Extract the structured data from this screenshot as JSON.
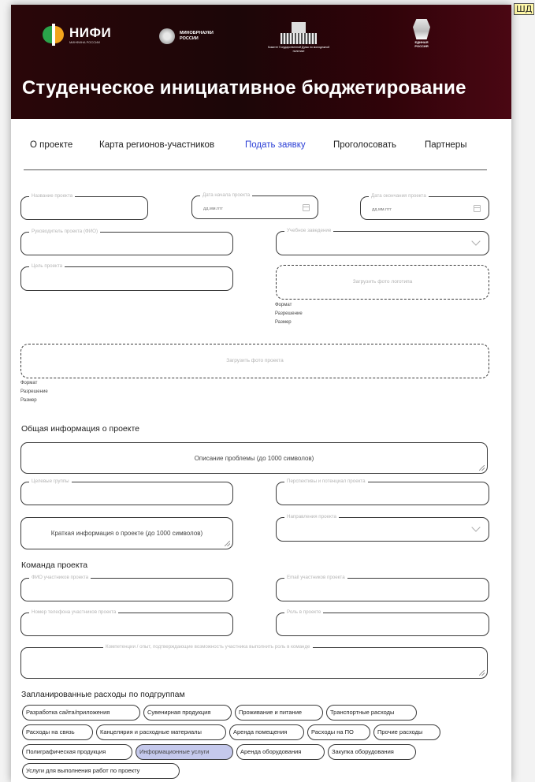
{
  "corner_tag": "ШД",
  "header": {
    "nifi_name": "НИФИ",
    "nifi_sub": "МИНФИНА РОССИИ",
    "min_line1": "МИНОБРНАУКИ",
    "min_line2": "РОССИИ",
    "duma_text": "Комитет Государственной Думы по молодежной политике",
    "er_text1": "ЕДИНАЯ",
    "er_text2": "РОССИЯ",
    "title": "Студенческое инициативное бюджетирование"
  },
  "nav": {
    "items": [
      "О проекте",
      "Карта регионов-участников",
      "Подать заявку",
      "Проголосовать",
      "Партнеры"
    ],
    "active": "Подать заявку"
  },
  "form": {
    "project_name": "Название проекта",
    "start_date": "Дата начала проекта",
    "end_date": "Дата окончания проекта",
    "date_placeholder": "дд.мм.гггг",
    "leader": "Руководитель проекта (ФИО)",
    "institution": "Учебное заведение",
    "goal": "Цель проекта",
    "upload_logo": "Загрузить фото логотипа",
    "format": "Формат",
    "resolution": "Разрешение",
    "size": "Размер",
    "upload_photo": "Загрузить фото проекта"
  },
  "general": {
    "title": "Общая информация о проекте",
    "problem": "Описание проблемы (до 1000 символов)",
    "target_groups": "Целевые группы",
    "prospects": "Перспективы и потенциал проекта",
    "brief": "Краткая информация о проекте (до 1000 символов)",
    "directions": "Направления проекта"
  },
  "team": {
    "title": "Команда проекта",
    "names": "ФИО участников проекта",
    "email": "Email участников проекта",
    "phone": "Номер телефона участников проекта",
    "role": "Роль в проекте",
    "competencies": "Компетенции / опыт, подтверждающие возможность участника выполнить роль в команде"
  },
  "expenses": {
    "title": "Запланированные расходы по подгруппам",
    "chips": [
      "Разработка сайта/приложения",
      "Сувенирная продукция",
      "Проживание и питание",
      "Транспортные расходы",
      "Расходы на связь",
      "Канцелярия и расходные материалы",
      "Аренда помещения",
      "Расходы на ПО",
      "Прочие расходы",
      "Полиграфическая продукция",
      "Информационные услуги",
      "Аренда оборудования",
      "Закупка оборудования",
      "Услуги для выполнения работ по проекту"
    ],
    "selected": "Информационные услуги",
    "selected_color": "#c5c9ec"
  },
  "colors": {
    "hero_dark": "#1c0608",
    "hero_accent": "#4a0713",
    "nav_active": "#2b3fd6",
    "nifi_green": "#2aa34a",
    "nifi_orange": "#f2a41c"
  }
}
